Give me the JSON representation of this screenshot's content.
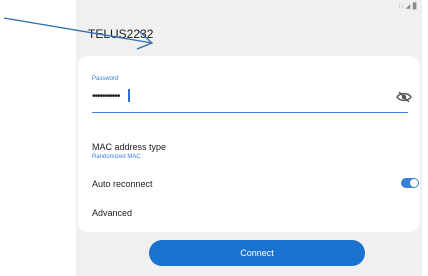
{
  "status_bar": {
    "icons": "∷ ◢ ▊"
  },
  "network": {
    "name": "TELUS2232"
  },
  "password": {
    "label": "Password",
    "value": "•••••••••••"
  },
  "mac": {
    "label": "MAC address type",
    "value": "Randomized MAC"
  },
  "auto_reconnect": {
    "label": "Auto reconnect",
    "enabled": true
  },
  "advanced": {
    "label": "Advanced"
  },
  "connect": {
    "label": "Connect"
  },
  "colors": {
    "accent": "#3b7ed6",
    "button": "#1a73d1",
    "arrow": "#2e6db0"
  },
  "icons": {
    "password_visibility": "eye-off-icon",
    "annotation": "arrow-icon"
  }
}
